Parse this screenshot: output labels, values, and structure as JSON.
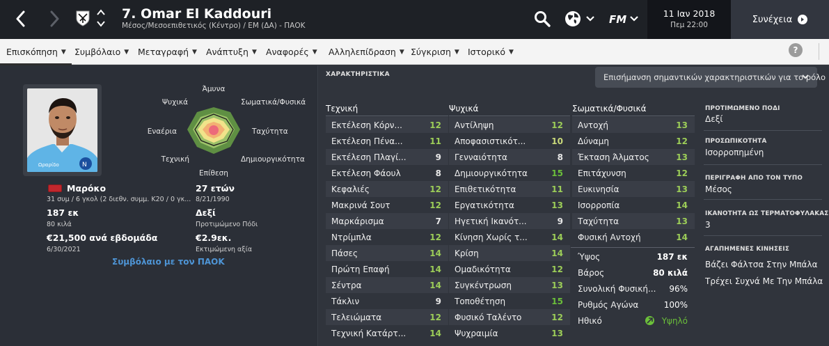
{
  "header": {
    "title": "7. Omar El Kaddouri",
    "subtitle": "Μέσος/Μεσοεπιθετικός (Κέντρο) / ΕΜ (ΔΑ) - ΠΑΟΚ",
    "date": "11 Ιαν 2018",
    "time": "Πεμ 22:00",
    "continue_label": "Συνέχεια"
  },
  "tabs": [
    {
      "label": "Επισκόπηση",
      "active": true
    },
    {
      "label": "Συμβόλαιο"
    },
    {
      "label": "Μεταγραφή"
    },
    {
      "label": "Ανάπτυξη"
    },
    {
      "label": "Αναφορές"
    },
    {
      "label": "Αλληλεπίδραση"
    },
    {
      "label": "Σύγκριση"
    },
    {
      "label": "Ιστορικό"
    }
  ],
  "help_label": "?",
  "profile": {
    "nationality": "Μαρόκο",
    "caps_line": "31 συμ / 6 γκολ (2 διεθν. συμμ. Κ20 / 0 γκ...",
    "height": "187 εκ",
    "weight": "80 κιλά",
    "wage": "€21,500 ανά εβδομάδα",
    "contract_end": "6/30/2021",
    "age": "27 ετών",
    "dob": "8/21/1990",
    "preferred_foot": "Δεξί",
    "preferred_foot_label": "Προτιμώμενο Πόδι",
    "value": "€2.9εκ.",
    "value_label": "Εκτιμώμενη αξία",
    "contract_link": "Συμβόλαιο με τον ΠΑΟΚ",
    "photo_shirt_text": "Ωραρίδο"
  },
  "radar": {
    "labels": {
      "top": "Άμυνα",
      "top_right": "Σωματικά/Φυσικά",
      "right": "Ταχύτητα",
      "bottom_right": "Δημιουργικότητα",
      "bottom": "Επίθεση",
      "bottom_left": "Τεχνική",
      "left": "Εναέρια",
      "top_left": "Ψυχικά"
    }
  },
  "attributes": {
    "heading": "ΧΑΡΑΚΤΗΡΙΣΤΙΚΑ",
    "highlight_label": "Επισήμανση σημαντικών χαρακτηριστικών για το ρόλο",
    "technical_title": "Τεχνική",
    "mental_title": "Ψυχικά",
    "physical_title": "Σωματικά/Φυσικά",
    "technical": [
      {
        "name": "Εκτέλεση Κόρν...",
        "value": "12"
      },
      {
        "name": "Εκτέλεση Πένα...",
        "value": "11"
      },
      {
        "name": "Εκτέλεση Πλαγί...",
        "value": "9"
      },
      {
        "name": "Εκτέλεση Φάουλ",
        "value": "8"
      },
      {
        "name": "Κεφαλιές",
        "value": "12"
      },
      {
        "name": "Μακρινά Σουτ",
        "value": "12"
      },
      {
        "name": "Μαρκάρισμα",
        "value": "7"
      },
      {
        "name": "Ντρίμπλα",
        "value": "12"
      },
      {
        "name": "Πάσες",
        "value": "14"
      },
      {
        "name": "Πρώτη Επαφή",
        "value": "14"
      },
      {
        "name": "Σέντρα",
        "value": "14"
      },
      {
        "name": "Τάκλιν",
        "value": "9"
      },
      {
        "name": "Τελειώματα",
        "value": "12"
      },
      {
        "name": "Τεχνική Κατάρτ...",
        "value": "14"
      }
    ],
    "mental": [
      {
        "name": "Αντίληψη",
        "value": "12"
      },
      {
        "name": "Αποφασιστικότ...",
        "value": "10"
      },
      {
        "name": "Γενναιότητα",
        "value": "8"
      },
      {
        "name": "Δημιουργικότητα",
        "value": "15"
      },
      {
        "name": "Επιθετικότητα",
        "value": "11"
      },
      {
        "name": "Εργατικότητα",
        "value": "13"
      },
      {
        "name": "Ηγετική Ικανότ...",
        "value": "9"
      },
      {
        "name": "Κίνηση Χωρίς τ...",
        "value": "14"
      },
      {
        "name": "Κρίση",
        "value": "14"
      },
      {
        "name": "Ομαδικότητα",
        "value": "12"
      },
      {
        "name": "Συγκέντρωση",
        "value": "13"
      },
      {
        "name": "Τοποθέτηση",
        "value": "15"
      },
      {
        "name": "Φυσικό Ταλέντο",
        "value": "12"
      },
      {
        "name": "Ψυχραιμία",
        "value": "13"
      }
    ],
    "physical": [
      {
        "name": "Αντοχή",
        "value": "13"
      },
      {
        "name": "Δύναμη",
        "value": "12"
      },
      {
        "name": "Έκταση Άλματος",
        "value": "13"
      },
      {
        "name": "Επιτάχυνση",
        "value": "12"
      },
      {
        "name": "Ευκινησία",
        "value": "13"
      },
      {
        "name": "Ισορροπία",
        "value": "14"
      },
      {
        "name": "Ταχύτητα",
        "value": "13"
      },
      {
        "name": "Φυσική Αντοχή",
        "value": "14"
      }
    ],
    "extra": [
      {
        "name": "Ύψος",
        "value": "187 εκ"
      },
      {
        "name": "Βάρος",
        "value": "80 κιλά"
      },
      {
        "name": "Συνολική Φυσική...",
        "value": "96%"
      },
      {
        "name": "Ρυθμός Αγώνα",
        "value": "100%"
      },
      {
        "name": "Ηθικό",
        "value": "Υψηλό"
      }
    ]
  },
  "side_info": {
    "foot_label": "ΠΡΟΤΙΜΩΜΕΝΟ ΠΟΔΙ",
    "foot_value": "Δεξί",
    "personality_label": "ΠΡΟΣΩΠΙΚΟΤΗΤΑ",
    "personality_value": "Ισορροπημένη",
    "media_label": "ΠΕΡΙΓΡΑΦΗ ΑΠΟ ΤΟΝ ΤΥΠΟ",
    "media_value": "Μέσος",
    "gk_label": "ΙΚΑΝΟΤΗΤΑ ΩΣ ΤΕΡΜΑΤΟΦΥΛΑΚΑΣ",
    "gk_value": "3",
    "moves_label": "ΑΓΑΠΗΜΕΝΕΣ ΚΙΝΗΣΕΙΣ",
    "moves": [
      "Βάζει Φάλτσα Στην Μπάλα",
      "Τρέχει Συχνά Με Την Μπάλα"
    ]
  },
  "colors": {
    "accent_link": "#4e95d6",
    "value_top": "#6bbf3a",
    "value_high": "#9ccd58",
    "value_mid": "#c9d97a",
    "value_low": "#e8e8e8",
    "topbar": "#1e2126"
  },
  "icons": {
    "back": "chevron-left-icon",
    "forward": "chevron-right-icon",
    "search": "search-icon",
    "globe": "globe-icon",
    "fm": "fm-logo-icon",
    "continue": "play-circle-icon",
    "morale": "arrow-up-icon"
  }
}
